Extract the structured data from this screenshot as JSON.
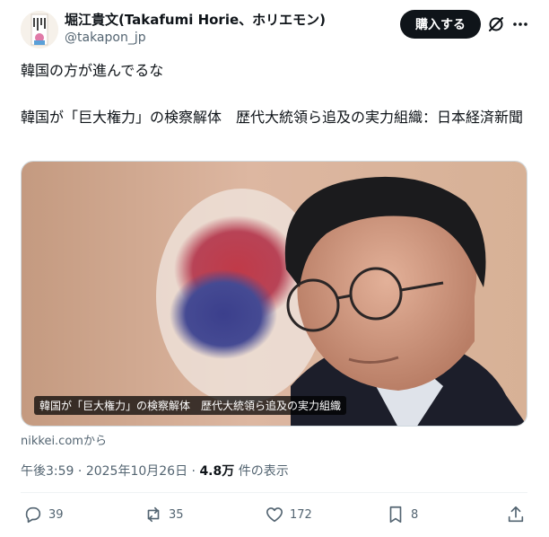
{
  "user": {
    "name": "堀江貴文(Takafumi Horie、ホリエモン)",
    "handle": "@takapon_jp"
  },
  "header": {
    "buy_label": "購入する"
  },
  "tweet": {
    "line1": "韓国の方が進んでるな",
    "line2": "韓国が「巨大権力」の検察解体　歴代大統領ら追及の実力組織：日本経済新聞"
  },
  "card": {
    "headline": "韓国が「巨大権力」の検察解体　歴代大統領ら追及の実力組織",
    "source": "nikkei.comから"
  },
  "meta": {
    "time": "午後3:59",
    "separator": " · ",
    "date": "2025年10月26日",
    "views": "4.8万",
    "views_suffix": " 件の表示"
  },
  "actions": {
    "replies": "39",
    "reposts": "35",
    "likes": "172",
    "bookmarks": "8"
  },
  "icons": [
    "grok-icon",
    "more-icon",
    "reply-icon",
    "repost-icon",
    "like-icon",
    "bookmark-icon",
    "share-icon"
  ]
}
